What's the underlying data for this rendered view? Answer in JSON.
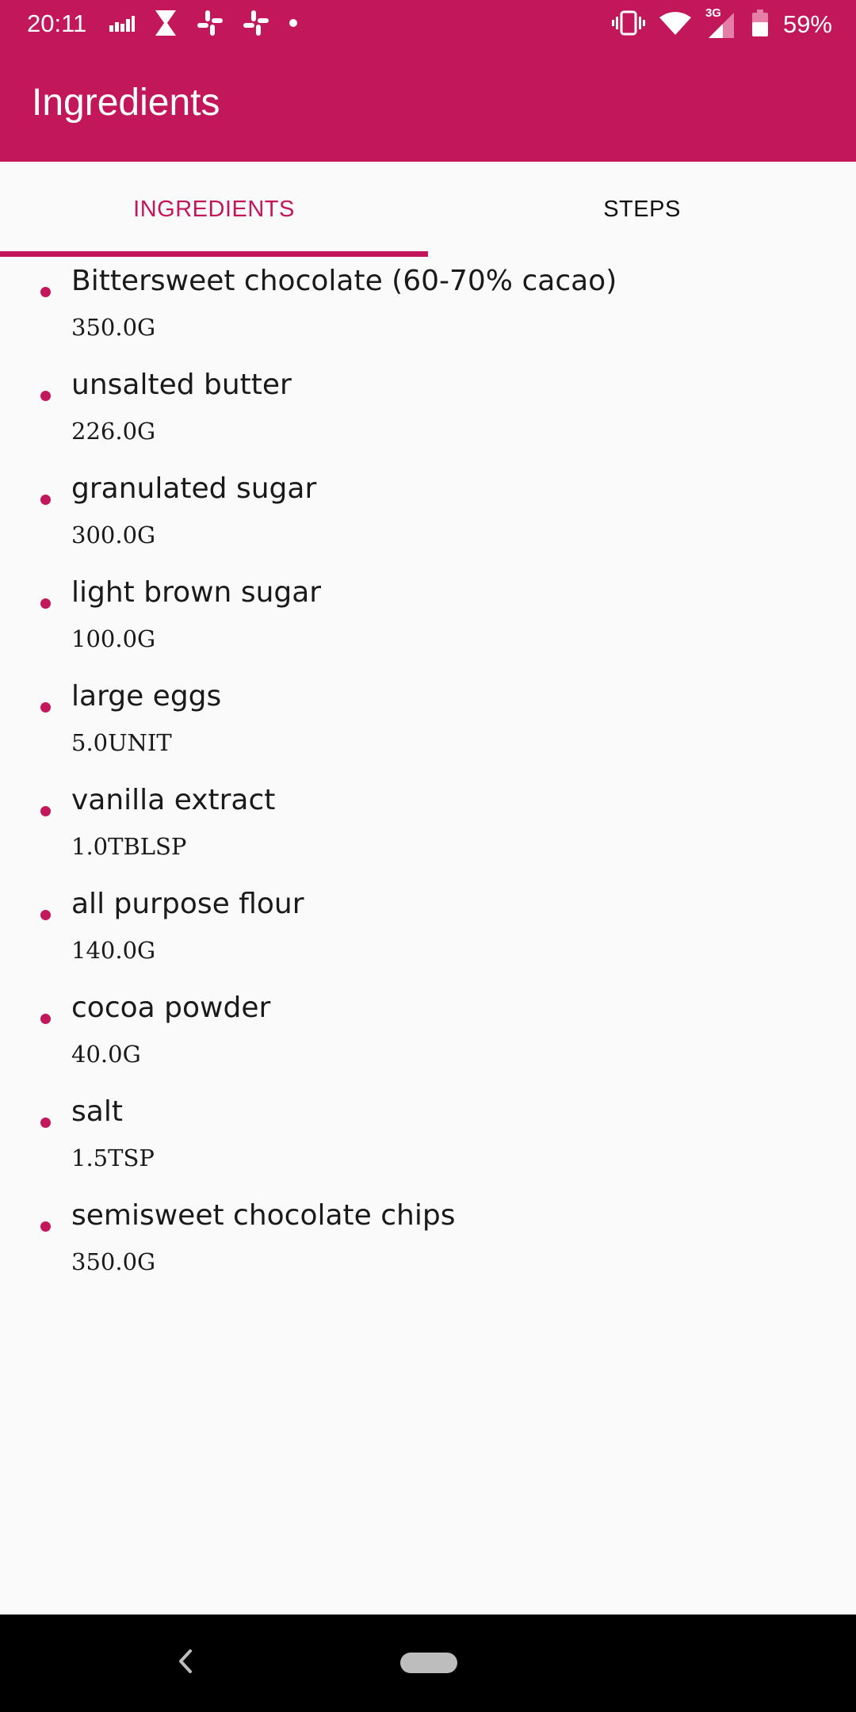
{
  "status_bar": {
    "time": "20:11",
    "network_type": "3G",
    "battery_percent": "59%",
    "icons": [
      "signal-bars-icon",
      "hourglass-icon",
      "slack-icon",
      "slack-icon",
      "dot-icon",
      "vibrate-icon",
      "wifi-icon",
      "cellular-3g-icon",
      "battery-icon"
    ]
  },
  "app_bar": {
    "title": "Ingredients"
  },
  "tabs": [
    {
      "label": "INGREDIENTS",
      "active": true
    },
    {
      "label": "STEPS",
      "active": false
    }
  ],
  "ingredients": [
    {
      "name": "Bittersweet chocolate (60-70% cacao)",
      "quantity": "350.0G"
    },
    {
      "name": "unsalted butter",
      "quantity": "226.0G"
    },
    {
      "name": "granulated sugar",
      "quantity": "300.0G"
    },
    {
      "name": "light brown sugar",
      "quantity": "100.0G"
    },
    {
      "name": "large eggs",
      "quantity": "5.0UNIT"
    },
    {
      "name": "vanilla extract",
      "quantity": "1.0TBLSP"
    },
    {
      "name": "all purpose flour",
      "quantity": "140.0G"
    },
    {
      "name": "cocoa powder",
      "quantity": "40.0G"
    },
    {
      "name": "salt",
      "quantity": "1.5TSP"
    },
    {
      "name": "semisweet chocolate chips",
      "quantity": "350.0G"
    }
  ],
  "colors": {
    "primary": "#c2185b",
    "background": "#fafafa",
    "nav_bar": "#000000"
  },
  "nav_bar": {
    "icons": [
      "back-icon",
      "home-pill-icon"
    ]
  }
}
